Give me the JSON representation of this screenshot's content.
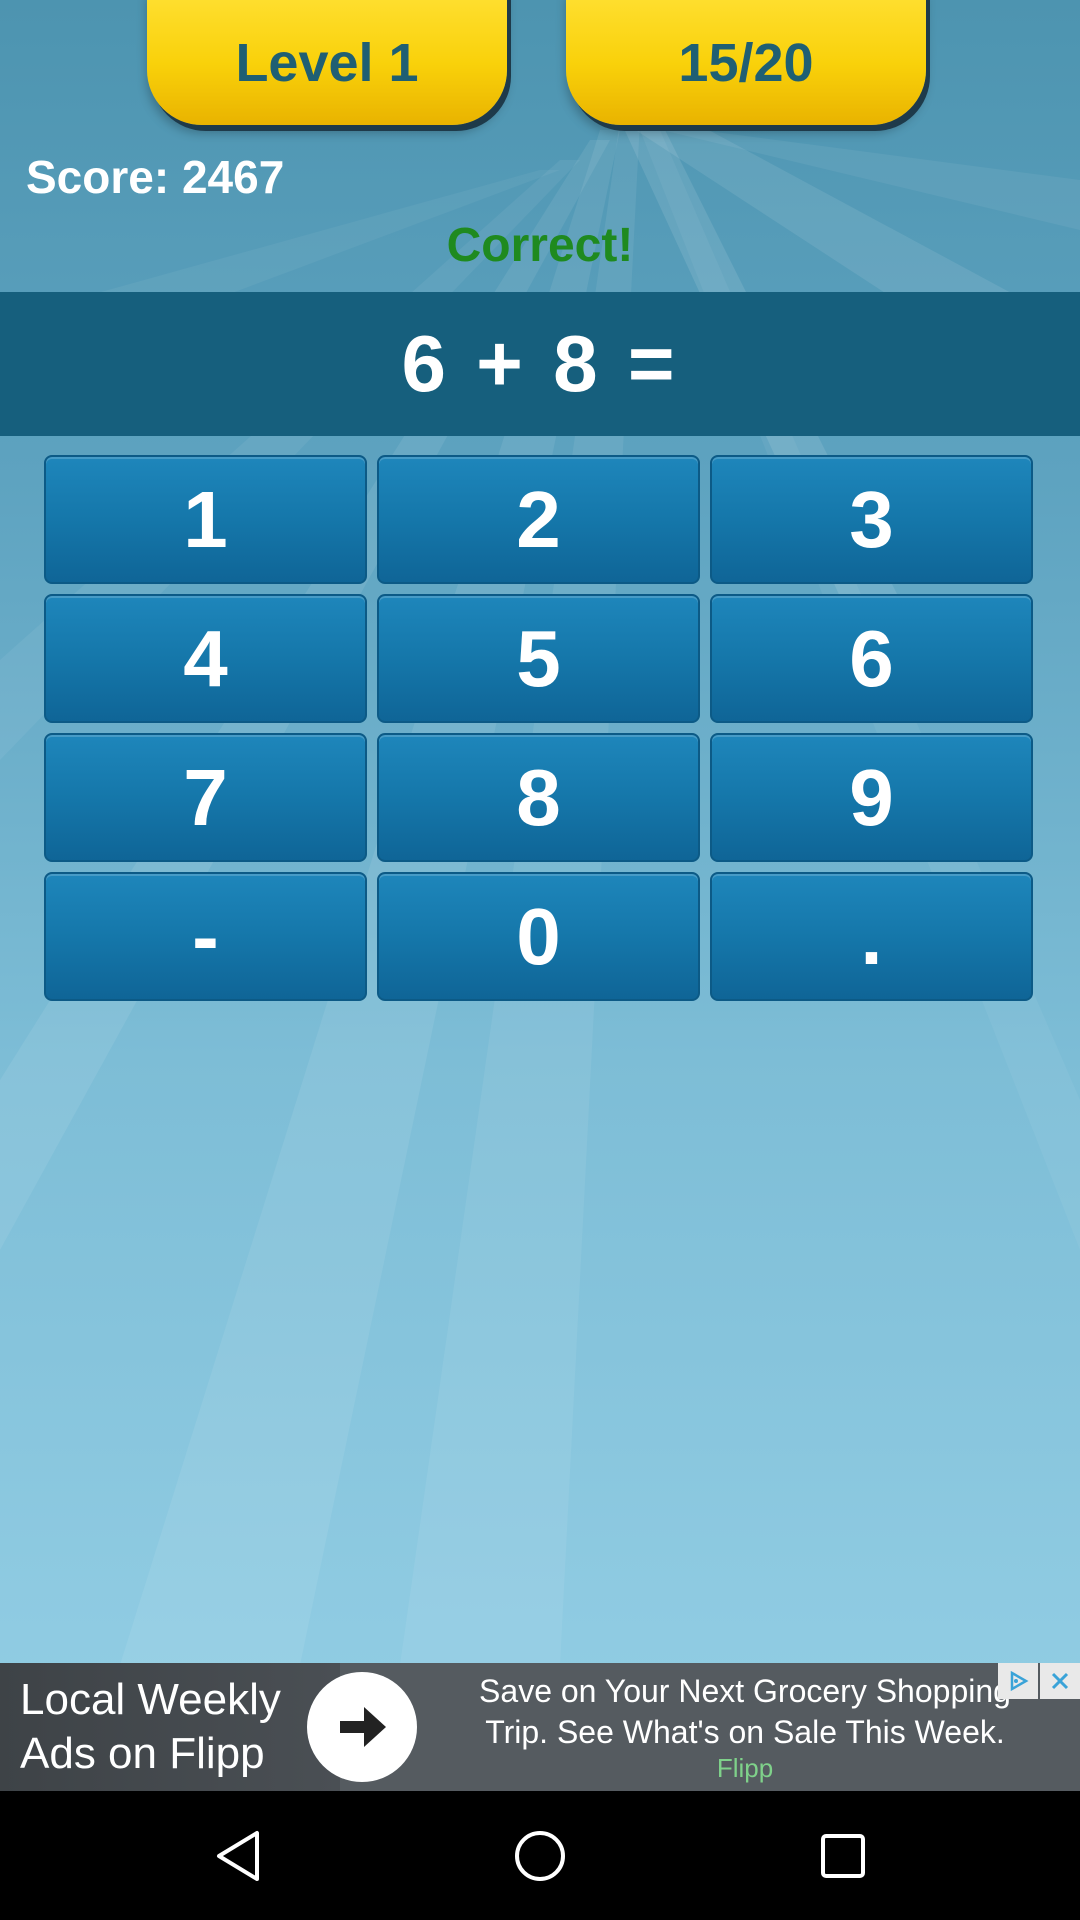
{
  "header": {
    "level_label": "Level 1",
    "progress_label": "15/20"
  },
  "score_label": "Score: 2467",
  "feedback": "Correct!",
  "question": "6 + 8 =",
  "keypad": {
    "keys": [
      "1",
      "2",
      "3",
      "4",
      "5",
      "6",
      "7",
      "8",
      "9",
      "-",
      "0",
      "."
    ]
  },
  "ad": {
    "left_line1": "Local Weekly",
    "left_line2": "Ads on Flipp",
    "headline_line1": "Save on Your Next Grocery Shopping",
    "headline_line2": "Trip. See What's on Sale This Week.",
    "brand": "Flipp",
    "arrow_icon": "arrow-right-icon",
    "adchoices_icon": "adchoices-icon",
    "close_icon": "close-icon"
  },
  "navbar": {
    "back_icon": "back-triangle-icon",
    "home_icon": "home-circle-icon",
    "recents_icon": "recents-square-icon"
  },
  "colors": {
    "tab_yellow": "#f9d10a",
    "tab_text": "#1f5f73",
    "feedback_green": "#1f8a1f",
    "question_bar": "#165f7d",
    "key_blue": "#1577aa"
  }
}
